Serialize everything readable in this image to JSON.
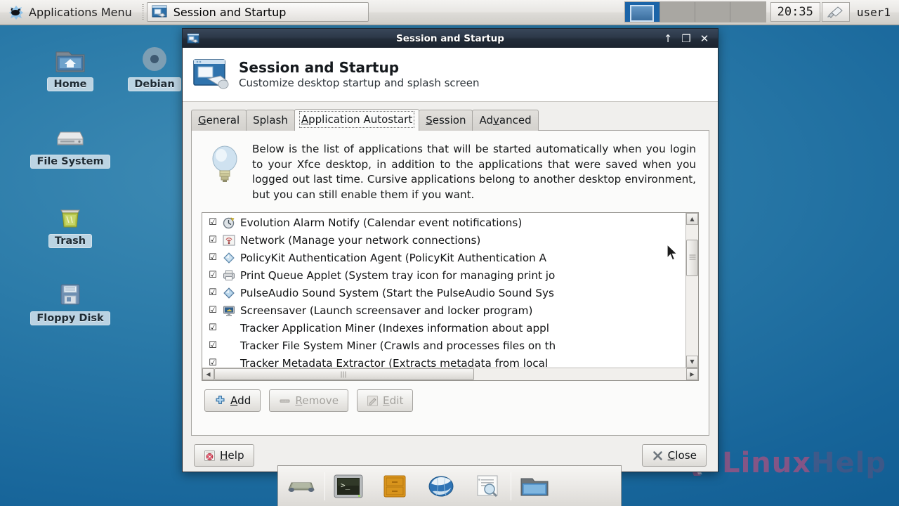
{
  "desktop": {
    "background_color": "#1b6d9f",
    "icons": [
      {
        "label": "Home",
        "icon": "home-folder-icon"
      },
      {
        "label": "Debian",
        "icon": "cd-disc-icon"
      },
      {
        "label": "File System",
        "icon": "hard-drive-icon"
      },
      {
        "label": "Trash",
        "icon": "trash-can-icon"
      },
      {
        "label": "Floppy Disk",
        "icon": "floppy-disk-icon"
      }
    ],
    "watermark": {
      "text_bright": "Linux",
      "text_dim": "Help"
    }
  },
  "top_panel": {
    "applications_menu_label": "Applications Menu",
    "applications_menu_icon": "xfce-mouse-icon",
    "task_button_label": "Session and Startup",
    "task_button_icon": "session-startup-icon",
    "workspaces": [
      {
        "active": true
      },
      {
        "active": false
      },
      {
        "active": false
      },
      {
        "active": false
      }
    ],
    "clock": "20:35",
    "tray_icon": "usb-device-icon",
    "user": "user1"
  },
  "window": {
    "titlebar": {
      "title": "Session and Startup",
      "icon": "session-startup-icon",
      "buttons": [
        {
          "name": "shade-button",
          "glyph": "↑"
        },
        {
          "name": "maximize-button",
          "glyph": "❐"
        },
        {
          "name": "close-button",
          "glyph": "✕"
        }
      ]
    },
    "header": {
      "icon": "session-startup-large-icon",
      "title": "Session and Startup",
      "subtitle": "Customize desktop startup and splash screen"
    },
    "tabs": [
      {
        "label": "General",
        "mnemonic": "G",
        "active": false
      },
      {
        "label": "Splash",
        "mnemonic": "",
        "active": false
      },
      {
        "label": "Application Autostart",
        "mnemonic": "A",
        "active": true
      },
      {
        "label": "Session",
        "mnemonic": "S",
        "active": false
      },
      {
        "label": "Advanced",
        "mnemonic": "v",
        "active": false
      }
    ],
    "autostart_tab": {
      "info_icon": "lightbulb-icon",
      "info_text": "Below is the list of applications that will be started automatically when you login to your Xfce desktop, in addition to the applications that were saved when you logged out last time. Cursive applications belong to another desktop environment, but you can still enable them if you want.",
      "list": [
        {
          "checked": true,
          "icon": "alarm-clock-icon",
          "text": "Evolution Alarm Notify (Calendar event notifications)"
        },
        {
          "checked": true,
          "icon": "network-icon",
          "text": "Network (Manage your network connections)"
        },
        {
          "checked": true,
          "icon": "gem-diamond-icon",
          "text": "PolicyKit Authentication Agent (PolicyKit Authentication A"
        },
        {
          "checked": true,
          "icon": "printer-icon",
          "text": "Print Queue Applet (System tray icon for managing print jo"
        },
        {
          "checked": true,
          "icon": "gem-diamond-icon",
          "text": "PulseAudio Sound System (Start the PulseAudio Sound Sys"
        },
        {
          "checked": true,
          "icon": "monitor-icon",
          "text": "Screensaver (Launch screensaver and locker program)"
        },
        {
          "checked": true,
          "icon": "",
          "text": "Tracker Application Miner (Indexes information about appl"
        },
        {
          "checked": true,
          "icon": "",
          "text": "Tracker File System Miner (Crawls and processes files on th"
        },
        {
          "checked": true,
          "icon": "",
          "text": "Tracker Metadata Extractor (Extracts metadata from local "
        }
      ],
      "buttons": [
        {
          "name": "add-button",
          "label": "Add",
          "mnemonic": "A",
          "icon": "plus-icon",
          "enabled": true
        },
        {
          "name": "remove-button",
          "label": "Remove",
          "mnemonic": "R",
          "icon": "minus-icon",
          "enabled": false
        },
        {
          "name": "edit-button",
          "label": "Edit",
          "mnemonic": "E",
          "icon": "pencil-icon",
          "enabled": false
        }
      ],
      "vertical_scrollbar": {
        "thumb_top_pct": 11,
        "thumb_height_pct": 28
      },
      "horizontal_scrollbar": {
        "thumb_left_pct": 0,
        "thumb_width_pct": 55
      }
    },
    "footer": {
      "help_label": "Help",
      "help_mnemonic": "H",
      "help_icon": "help-lifering-icon",
      "close_label": "Close",
      "close_mnemonic": "C",
      "close_icon": "x-close-icon"
    }
  },
  "dock": {
    "items": [
      {
        "name": "show-desktop-button",
        "icon": "show-desktop-icon"
      },
      {
        "name": "terminal-launcher",
        "icon": "terminal-icon"
      },
      {
        "name": "file-manager-launcher",
        "icon": "file-cabinet-icon"
      },
      {
        "name": "web-browser-launcher",
        "icon": "globe-icon"
      },
      {
        "name": "find-files-launcher",
        "icon": "search-document-icon"
      },
      {
        "name": "folder-launcher",
        "icon": "folder-icon"
      }
    ]
  }
}
